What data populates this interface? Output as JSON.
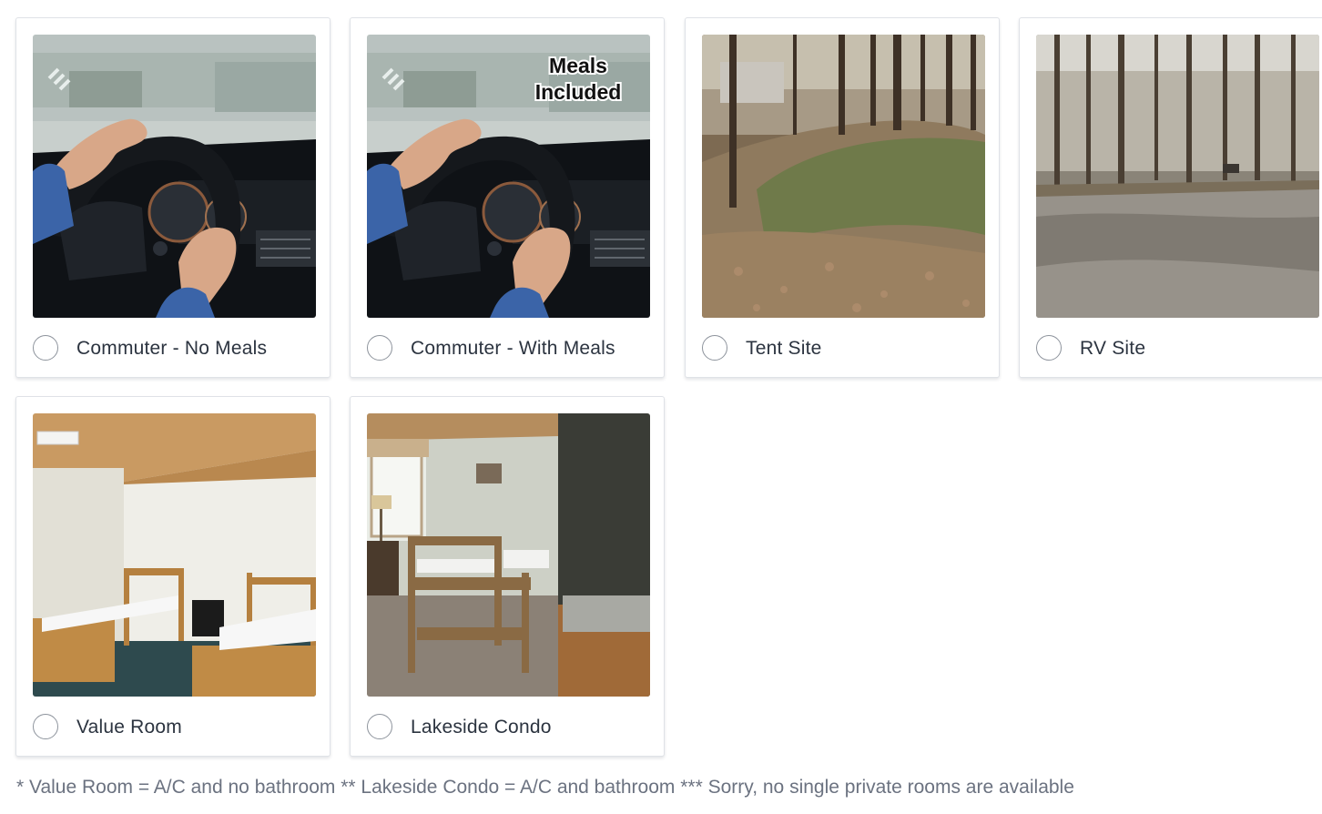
{
  "options": [
    {
      "label": "Commuter - No Meals",
      "selected": false,
      "image": "car-steering-wheel-photo"
    },
    {
      "label": "Commuter - With Meals",
      "selected": false,
      "image": "car-steering-wheel-photo",
      "overlay_text": "Meals\nIncluded"
    },
    {
      "label": "Tent Site",
      "selected": false,
      "image": "wooded-tent-site-photo"
    },
    {
      "label": "RV Site",
      "selected": false,
      "image": "rv-site-road-photo"
    },
    {
      "label": "Value Room",
      "selected": false,
      "image": "value-room-bunks-photo"
    },
    {
      "label": "Lakeside Condo",
      "selected": false,
      "image": "condo-bedroom-photo"
    }
  ],
  "footnote": "* Value Room = A/C and no bathroom ** Lakeside Condo = A/C and bathroom *** Sorry, no single private rooms are available"
}
